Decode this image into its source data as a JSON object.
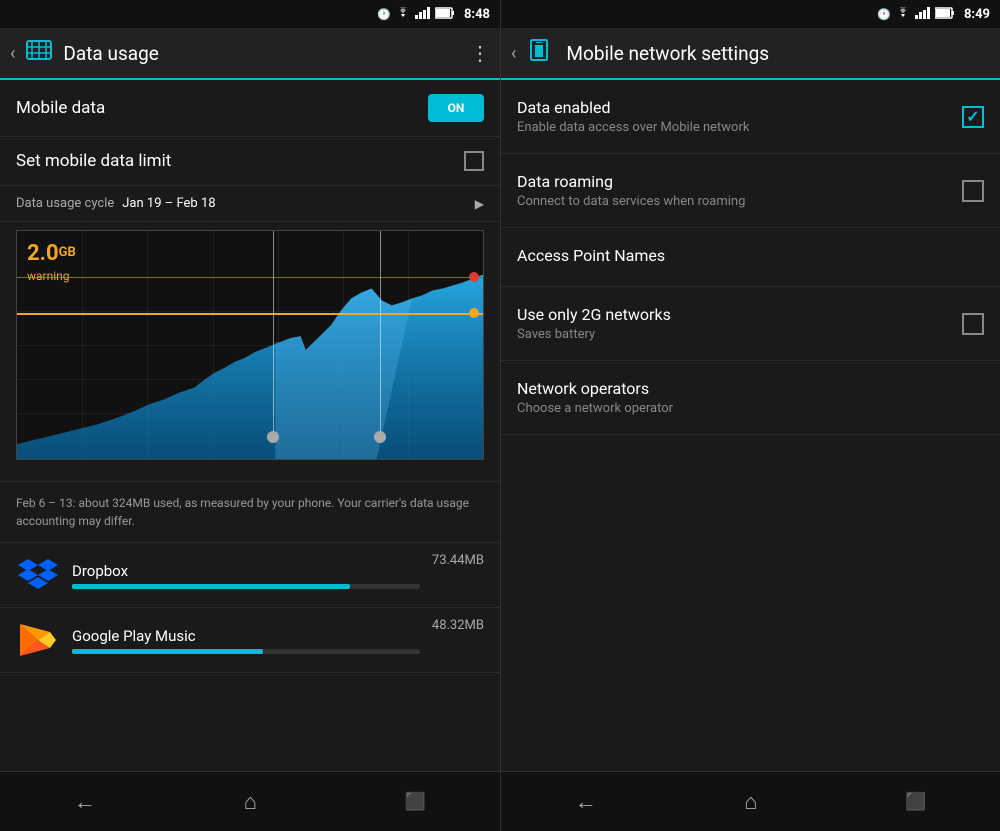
{
  "left": {
    "statusBar": {
      "time": "8:48",
      "icons": [
        "clock",
        "wifi",
        "signal",
        "battery"
      ]
    },
    "topBar": {
      "title": "Data usage",
      "menuIcon": "⋮"
    },
    "mobileData": {
      "label": "Mobile data",
      "toggle": "ON"
    },
    "setLimit": {
      "label": "Set mobile data limit"
    },
    "cycleRow": {
      "label": "Data usage cycle",
      "value": "Jan 19 – Feb 18"
    },
    "chart": {
      "value": "2.0",
      "unit": "GB",
      "sublabel": "warning"
    },
    "infoText": "Feb 6 – 13: about 324MB used, as measured by your phone. Your carrier's data usage accounting may differ.",
    "apps": [
      {
        "name": "Dropbox",
        "usage": "73.44MB",
        "barWidth": "80%",
        "icon": "dropbox"
      },
      {
        "name": "Google Play Music",
        "usage": "48.32MB",
        "barWidth": "55%",
        "icon": "gplay"
      }
    ],
    "bottomNav": {
      "back": "←",
      "home": "⌂",
      "recent": "▭"
    }
  },
  "right": {
    "statusBar": {
      "time": "8:49",
      "icons": [
        "clock",
        "wifi",
        "signal",
        "battery"
      ]
    },
    "topBar": {
      "title": "Mobile network settings",
      "backIcon": "‹"
    },
    "settings": [
      {
        "title": "Data enabled",
        "subtitle": "Enable data access over Mobile network",
        "type": "checkbox",
        "checked": true
      },
      {
        "title": "Data roaming",
        "subtitle": "Connect to data services when roaming",
        "type": "checkbox",
        "checked": false
      },
      {
        "title": "Access Point Names",
        "subtitle": "",
        "type": "none",
        "checked": false
      },
      {
        "title": "Use only 2G networks",
        "subtitle": "Saves battery",
        "type": "checkbox",
        "checked": false
      },
      {
        "title": "Network operators",
        "subtitle": "Choose a network operator",
        "type": "none",
        "checked": false
      }
    ],
    "bottomNav": {
      "back": "←",
      "home": "⌂",
      "recent": "▭"
    }
  }
}
